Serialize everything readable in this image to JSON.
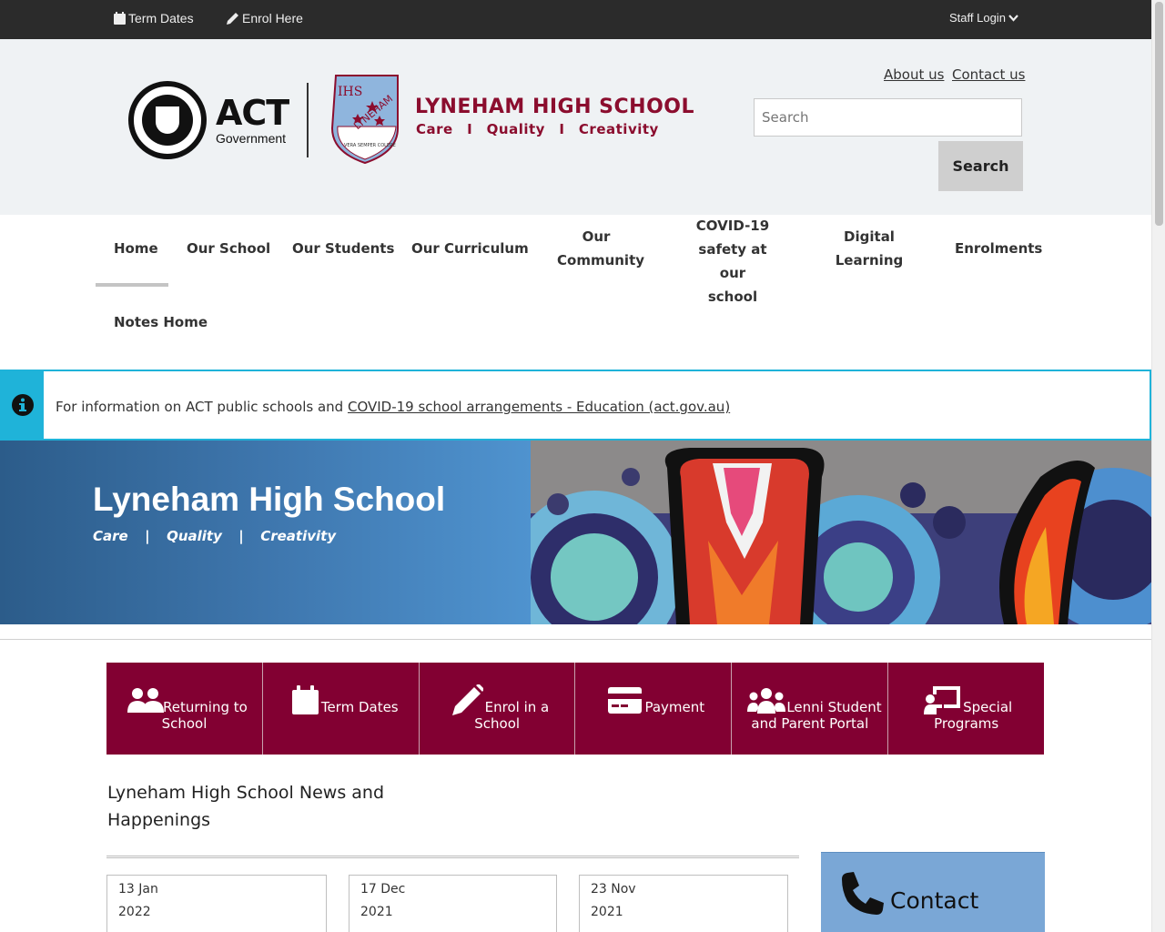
{
  "topbar": {
    "term_dates": "Term Dates",
    "enrol_here": "Enrol Here",
    "staff_login": "Staff Login"
  },
  "header": {
    "act_big": "ACT",
    "act_small": "Government",
    "school_name": "LYNEHAM HIGH SCHOOL",
    "school_motto": "Care  I  Quality  I  Creativity",
    "crest_text_a": "IHS",
    "crest_text_b": "LYNEHAM",
    "crest_text_c": "VERA SEMPER COLERE",
    "about_us": "About us",
    "contact_us": "Contact us",
    "search_placeholder": "Search",
    "search_button": "Search"
  },
  "nav": {
    "home": "Home",
    "our_school": "Our School",
    "our_students": "Our Students",
    "our_curriculum": "Our Curriculum",
    "our_community_1": "Our",
    "our_community_2": "Community",
    "covid_1": "COVID-19",
    "covid_2": "safety at our",
    "covid_3": "school",
    "digital_1": "Digital",
    "digital_2": "Learning",
    "enrolments": "Enrolments",
    "notes_home": "Notes Home"
  },
  "alert": {
    "text": "For information on ACT public schools and ",
    "link": "COVID-19 school arrangements - Education (act.gov.au)"
  },
  "banner": {
    "title": "Lyneham High School",
    "tagline": "Care  |  Quality  |  Creativity"
  },
  "quick_links": {
    "returning_1": "Returning to",
    "returning_2": "School",
    "term_dates": "Term Dates",
    "enrol_1": "Enrol in a",
    "enrol_2": "School",
    "payment": "Payment",
    "lenni_1": "Lenni Student",
    "lenni_2": "and Parent Portal",
    "special_1": "Special",
    "special_2": "Programs"
  },
  "news": {
    "title": "Lyneham High School News and Happenings",
    "cards": [
      {
        "day": "13 Jan",
        "year": "2022"
      },
      {
        "day": "17 Dec",
        "year": "2021"
      },
      {
        "day": "23 Nov",
        "year": "2021"
      }
    ]
  },
  "contact": {
    "label": "Contact"
  },
  "colors": {
    "maroon": "#820032",
    "alert_cyan": "#1fb3d9",
    "banner_blue": "#3e76ad",
    "contact_blue": "#7aa7d6"
  }
}
